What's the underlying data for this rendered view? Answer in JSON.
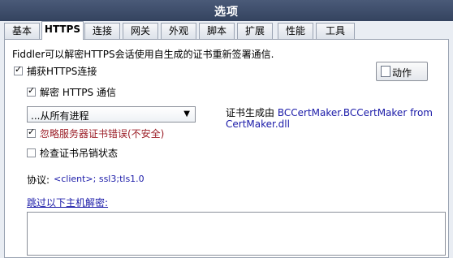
{
  "window": {
    "title": "选项"
  },
  "tabs": [
    {
      "label": "基本"
    },
    {
      "label": "HTTPS"
    },
    {
      "label": "连接"
    },
    {
      "label": "网关"
    },
    {
      "label": "外观"
    },
    {
      "label": "脚本"
    },
    {
      "label": "扩展"
    },
    {
      "label": "性能"
    },
    {
      "label": "工具"
    }
  ],
  "https": {
    "description": "Fiddler可以解密HTTPS会话使用自生成的证书重新签署通信.",
    "capture_label": "捕获HTTPS连接",
    "decrypt_label": "解密 HTTPS 通信",
    "process_select_value": "...从所有进程",
    "ignore_errors_label": "忽略服务器证书错误(不安全)",
    "check_revocation_label": "检查证书吊销状态",
    "protocols_label": "协议:",
    "protocols_value": "<client>; ssl3;tls1.0",
    "skip_hosts_link": "跳过以下主机解密:",
    "cert_prefix": "证书生成由",
    "cert_generator_1": "BCCertMaker.BCCertMaker from",
    "cert_generator_2": "CertMaker.dll",
    "action_button_label": "动作",
    "capture_checked": true,
    "decrypt_checked": true,
    "ignore_errors_checked": true,
    "check_revocation_checked": false
  }
}
